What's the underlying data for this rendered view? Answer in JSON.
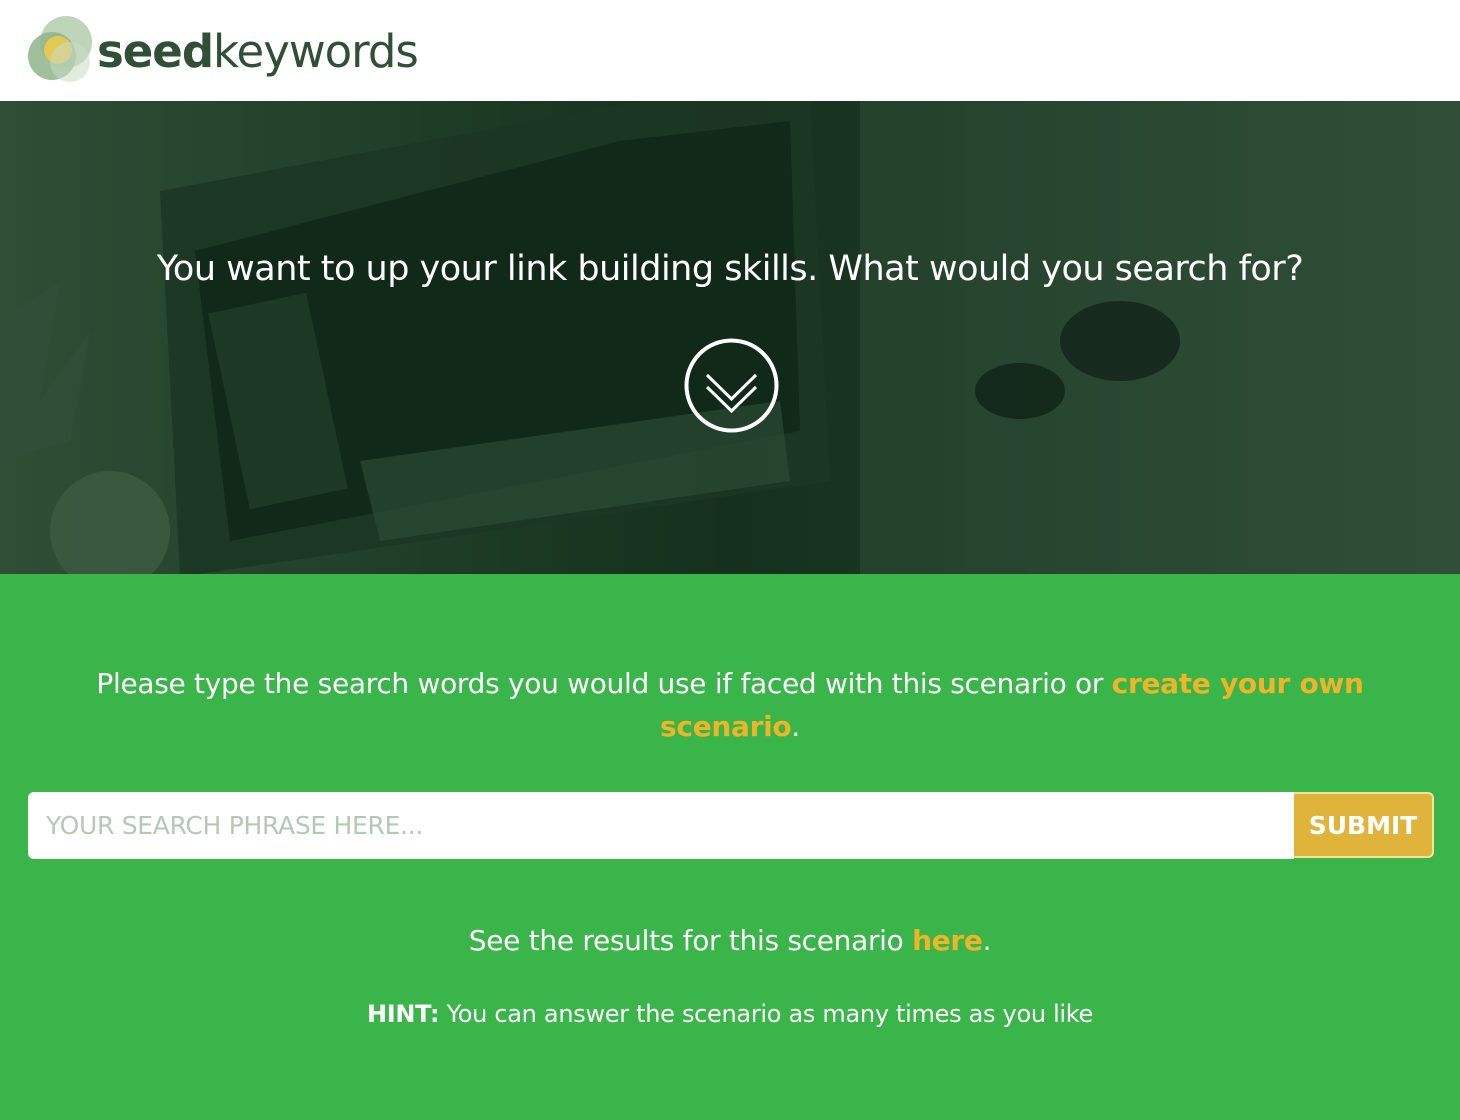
{
  "brand": {
    "name_bold": "seed",
    "name_regular": "keywords",
    "colors": {
      "text": "#2f4f36",
      "mark_green": "#8fb48a",
      "mark_yellow": "#e7c84f"
    }
  },
  "hero": {
    "question": "You want to up your link building skills. What would you search for?",
    "scroll_icon": "chevron-double-down-icon",
    "overlay_color": "#1f3d27"
  },
  "cta": {
    "background": "#3ab54a",
    "accent": "#f0b429",
    "prompt_text": "Please type the search words you would use if faced with this scenario or ",
    "prompt_link": "create your own scenario",
    "prompt_end": ".",
    "search": {
      "placeholder": "YOUR SEARCH PHRASE HERE...",
      "value": "",
      "submit_label": "SUBMIT"
    },
    "results_text": "See the results for this scenario ",
    "results_link": "here",
    "results_end": ".",
    "hint_label": "HINT:",
    "hint_text": " You can answer the scenario as many times as you like"
  }
}
